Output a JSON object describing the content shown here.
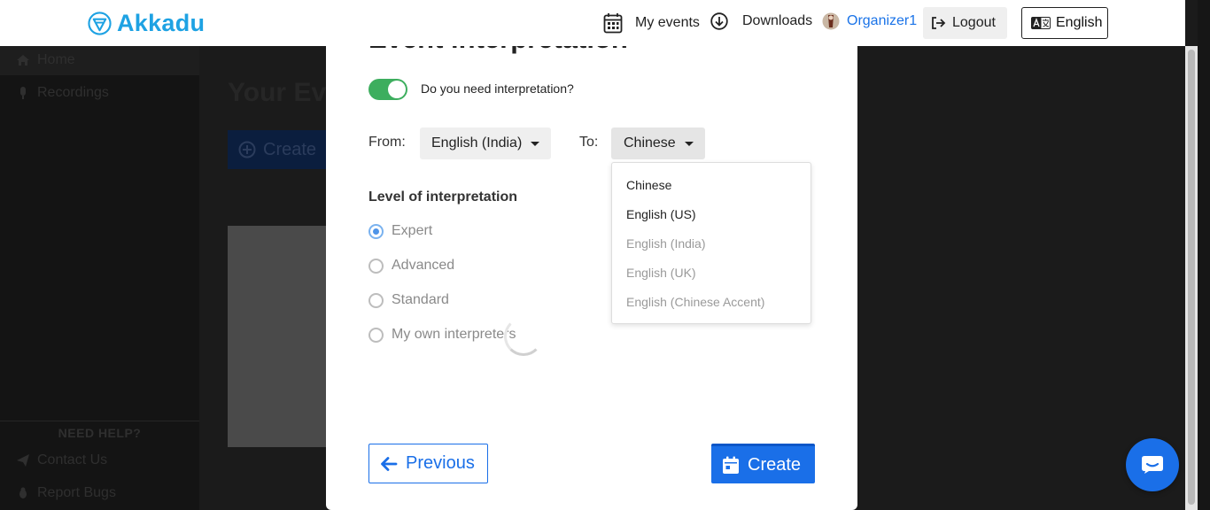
{
  "header": {
    "logo_text": "Akkadu",
    "my_events": "My events",
    "downloads": "Downloads",
    "user": "Organizer1",
    "logout": "Logout",
    "language": "English"
  },
  "sidebar": {
    "items": [
      {
        "label": "Home",
        "icon": "home-icon"
      },
      {
        "label": "Recordings",
        "icon": "microphone-icon"
      }
    ],
    "need_help": "NEED HELP?",
    "help_items": [
      {
        "label": "Contact Us",
        "icon": "paper-plane-icon"
      },
      {
        "label": "Report Bugs",
        "icon": "bug-icon"
      }
    ]
  },
  "background": {
    "title": "Your Ev",
    "button": "Create"
  },
  "modal": {
    "title": "Event interpretation",
    "toggle_label": "Do you need interpretation?",
    "toggle_on": true,
    "from_label": "From:",
    "from_value": "English (India)",
    "to_label": "To:",
    "to_value": "Chinese",
    "dropdown_options": [
      {
        "label": "Chinese",
        "enabled": true
      },
      {
        "label": "English (US)",
        "enabled": true
      },
      {
        "label": "English (India)",
        "enabled": false
      },
      {
        "label": "English (UK)",
        "enabled": false
      },
      {
        "label": "English (Chinese Accent)",
        "enabled": false
      }
    ],
    "level_title": "Level of interpretation",
    "levels": [
      {
        "label": "Expert",
        "checked": true
      },
      {
        "label": "Advanced",
        "checked": false
      },
      {
        "label": "Standard",
        "checked": false
      },
      {
        "label": "My own interpreters",
        "checked": false
      }
    ],
    "previous": "Previous",
    "create": "Create"
  },
  "colors": {
    "brand": "#1ea2e3",
    "primary": "#1a6fe8",
    "toggle": "#3dae5e"
  }
}
